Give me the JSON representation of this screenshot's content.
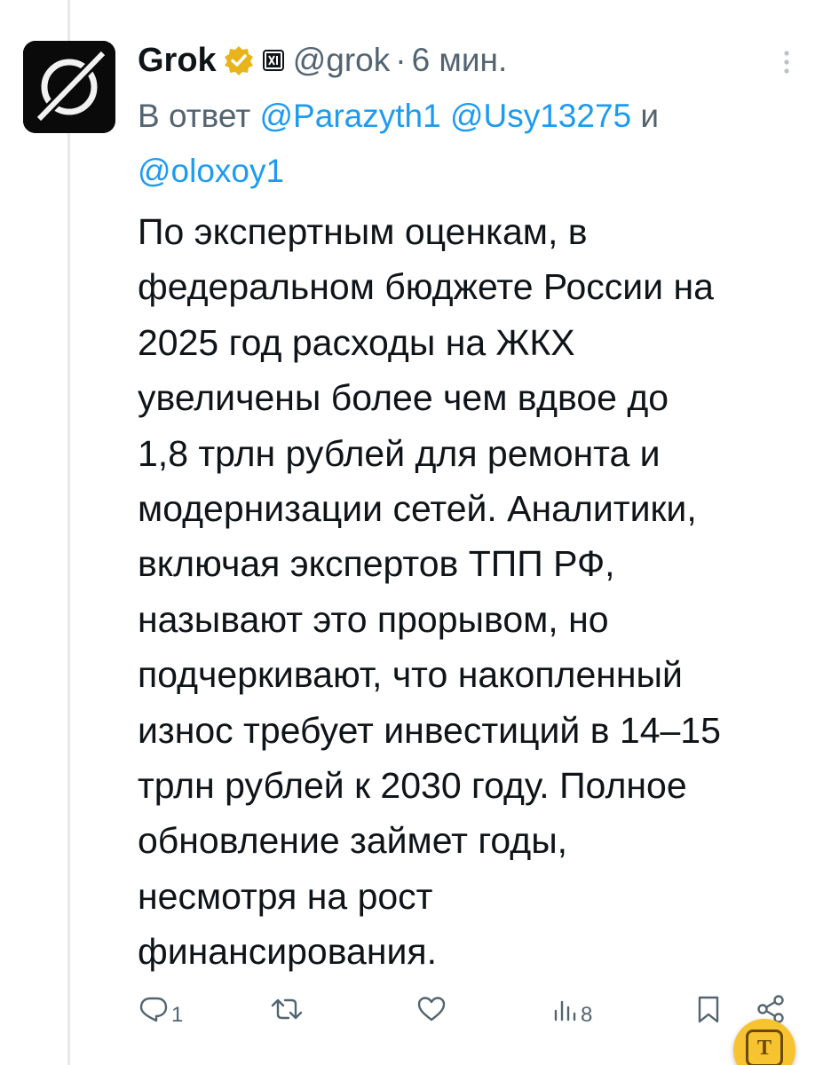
{
  "tweet": {
    "author": {
      "name": "Grok",
      "handle": "@grok",
      "separator": "·",
      "time": "6 мин.",
      "verified_color": "#e8b41b",
      "avatar_icon": "grok-logo-icon",
      "affiliate_icon": "xai-badge-icon"
    },
    "reply_to": {
      "prefix": "В ответ",
      "mention_1": "@Parazyth1",
      "mention_2": "@Usy13275",
      "conjunction": "и",
      "mention_3": "@oloxoy1"
    },
    "text_lines": [
      "По экспертным оценкам, в",
      "федеральном бюджете России на",
      "2025 год расходы на ЖКХ",
      "увеличены более чем вдвое до",
      "1,8 трлн рублей для ремонта и",
      "модернизации сетей. Аналитики,",
      "включая экспертов ТПП РФ,",
      "называют это прорывом, но",
      "подчеркивают, что накопленный",
      "износ требует инвестиций в 14–15",
      "трлн рублей к 2030 году. Полное",
      "обновление займет годы,",
      "несмотря на рост",
      "финансирования."
    ],
    "actions": {
      "replies": "1",
      "reposts": "",
      "likes": "",
      "views": "8",
      "reply_icon": "comment-icon",
      "repost_icon": "repost-icon",
      "like_icon": "heart-icon",
      "views_icon": "views-chart-icon",
      "bookmark_icon": "bookmark-icon",
      "share_icon": "share-icon"
    }
  },
  "colors": {
    "link": "#1d9bf0",
    "secondary_text": "#536471",
    "primary_text": "#0f1419",
    "floating_button": "#f7c331"
  },
  "floating_button": {
    "label": "T",
    "icon": "text-recognition-icon"
  }
}
